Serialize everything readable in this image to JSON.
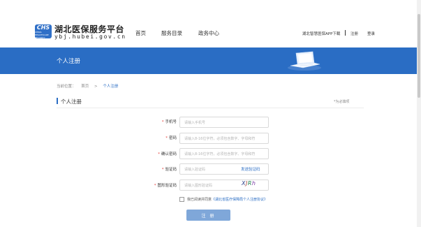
{
  "header": {
    "logo_text": "CHS",
    "logo_subtext": "CHINA HEALTHCARE SECURITY",
    "site_title": "湖北医保服务平台",
    "site_url": "ybj.hubei.gov.cn",
    "nav": [
      "首页",
      "服务目录",
      "政务中心"
    ],
    "app_download": "湖北智慧医保APP下载",
    "register": "注册",
    "login": "登录"
  },
  "banner": {
    "title": "个人注册",
    "illustration": "laptop-illustration"
  },
  "breadcrumb": {
    "prefix": "当前位置：",
    "home": "首页",
    "separator": ">",
    "current": "个人注册"
  },
  "section": {
    "title": "个人注册",
    "required_note": "*为必填项"
  },
  "form": {
    "phone_label": "手机号",
    "phone_placeholder": "请输入手机号",
    "password_label": "密码",
    "password_placeholder": "请输入8-16位字符，必须包含数字、字母和符",
    "confirm_label": "确认密码",
    "confirm_placeholder": "请输入8-16位字符，必须包含数字、字母和符",
    "code_label": "验证码",
    "code_placeholder": "请输入验证码",
    "send_code": "发送验证码",
    "image_code_label": "图形验证码",
    "image_code_placeholder": "请输入图形验证码",
    "captcha_chars": [
      "X",
      "J",
      "R",
      "h"
    ],
    "agree_prefix": "我已阅读并同意",
    "agree_link": "《湖北省医疗保障局个人注册协议》",
    "submit": "注 册"
  },
  "colors": {
    "brand_blue": "#2a6dc4",
    "button_disabled": "#7fa7d9",
    "required_star": "#e53935"
  }
}
